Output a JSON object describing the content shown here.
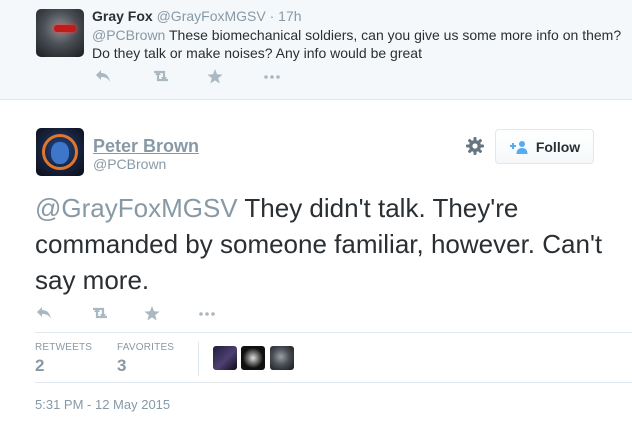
{
  "parent_tweet": {
    "name": "Gray Fox",
    "handle": "@GrayFoxMGSV",
    "time_sep": " · ",
    "time": "17h",
    "mention": "@PCBrown",
    "text": " These biomechanical soldiers, can you give us some more info on them? Do they talk or make noises? Any info would be great"
  },
  "tweet": {
    "name": "Peter Brown",
    "handle": "@PCBrown",
    "mention": "@GrayFoxMGSV",
    "text": " They didn't talk. They're commanded by someone familiar, however. Can't say more.",
    "follow_label": "Follow",
    "stats": {
      "retweets_label": "RETWEETS",
      "retweets": "2",
      "favorites_label": "FAVORITES",
      "favorites": "3"
    },
    "timestamp": "5:31 PM - 12 May 2015"
  },
  "icons": [
    "reply-icon",
    "retweet-icon",
    "favorite-icon",
    "more-icon",
    "gear-icon",
    "follow-person-icon"
  ],
  "colors": {
    "muted": "#8899a6",
    "text": "#292f33",
    "icon": "#aab8c2",
    "border": "#e1e8ed"
  }
}
